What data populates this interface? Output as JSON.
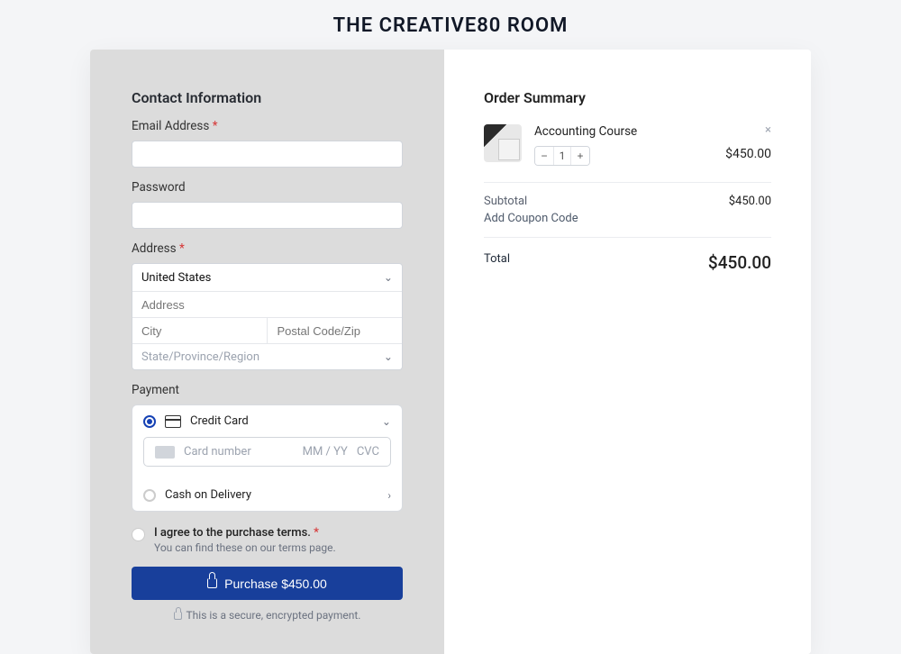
{
  "page_title": "THE CREATIVE80 ROOM",
  "left": {
    "section_title": "Contact Information",
    "email_label": "Email Address",
    "password_label": "Password",
    "address_label": "Address",
    "country": "United States",
    "address_placeholder": "Address",
    "city_placeholder": "City",
    "postal_placeholder": "Postal Code/Zip",
    "state_placeholder": "State/Province/Region",
    "payment_label": "Payment",
    "payment_cc": "Credit Card",
    "card_number_placeholder": "Card number",
    "exp_hint": "MM / YY",
    "cvc_hint": "CVC",
    "payment_cod": "Cash on Delivery",
    "terms_heading": "I agree to the purchase terms.",
    "terms_sub": "You can find these on our terms page.",
    "purchase_btn": "Purchase $450.00",
    "secure_note": "This is a secure, encrypted payment."
  },
  "right": {
    "title": "Order Summary",
    "item_name": "Accounting Course",
    "item_qty": "1",
    "item_price": "$450.00",
    "subtotal_label": "Subtotal",
    "subtotal_value": "$450.00",
    "coupon": "Add Coupon Code",
    "total_label": "Total",
    "total_value": "$450.00"
  }
}
